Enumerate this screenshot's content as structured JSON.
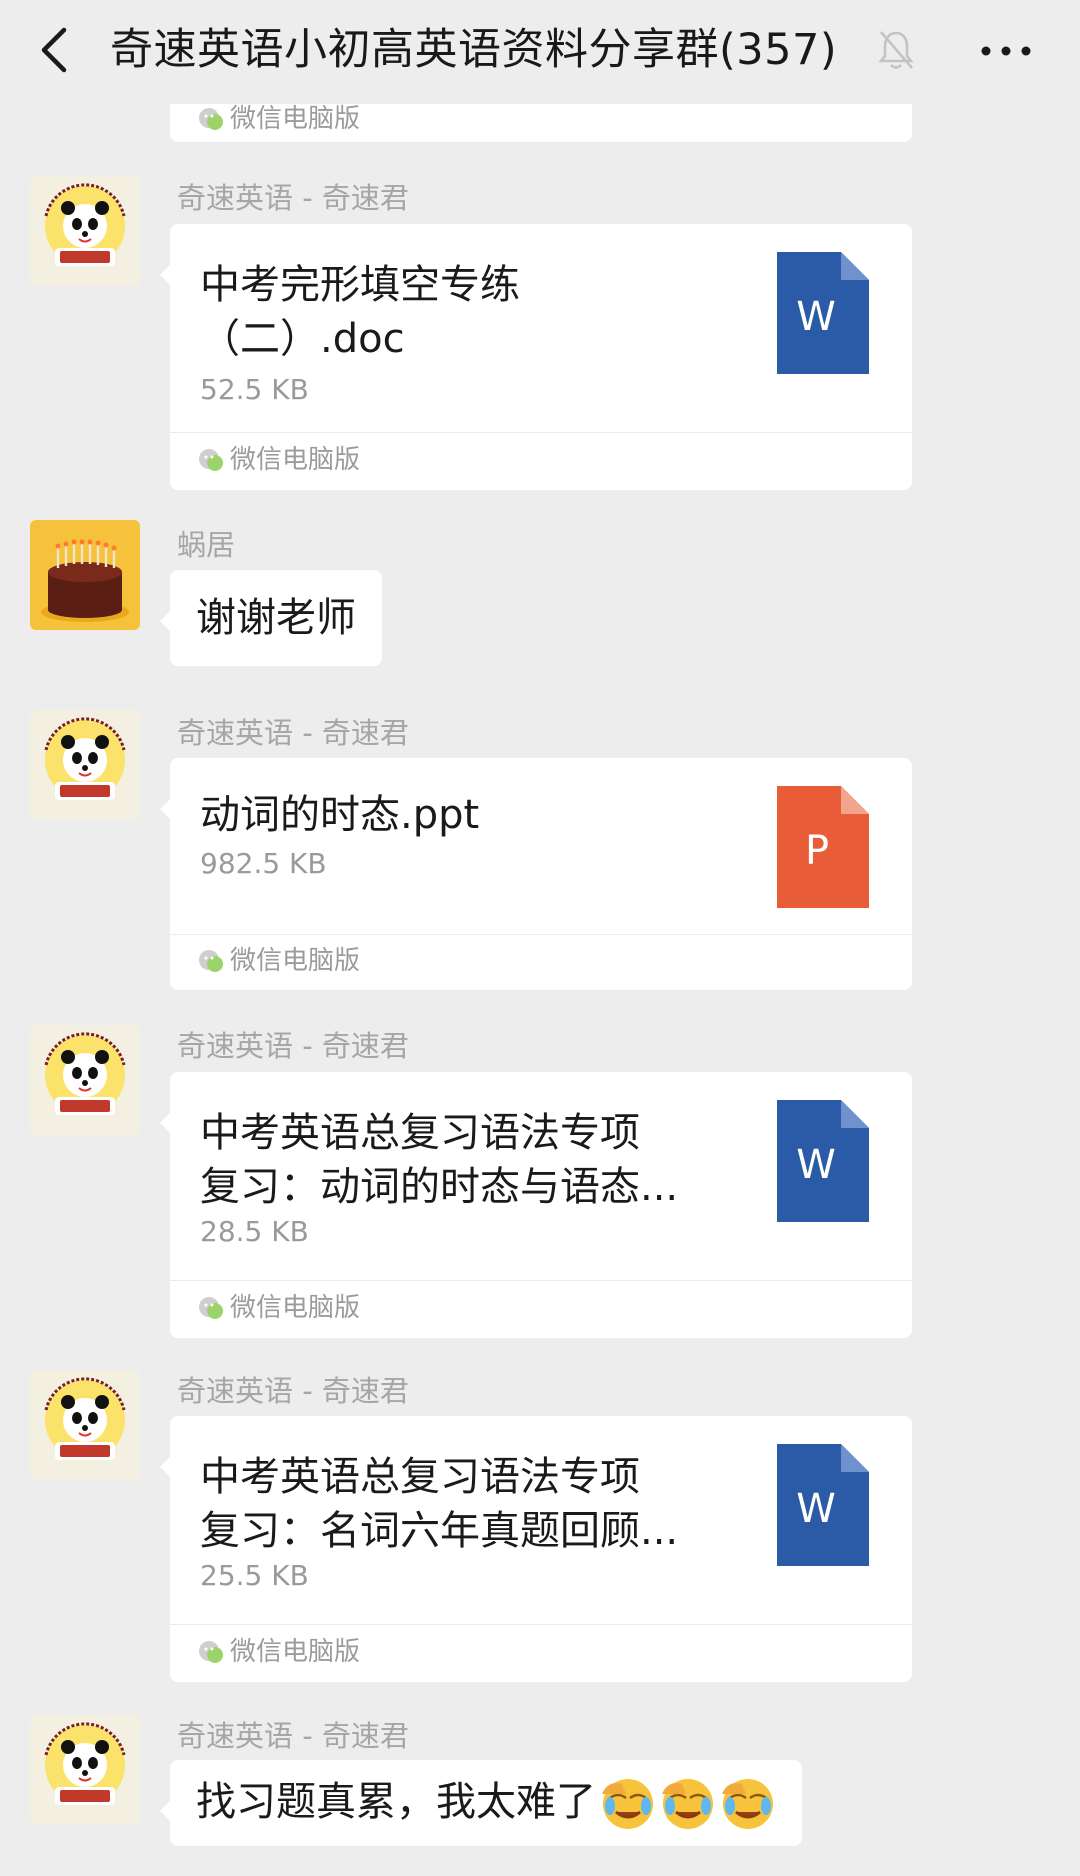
{
  "header": {
    "back_icon": "chevron-left-icon",
    "title": "奇速英语小初高英语资料分享群(357)",
    "mute_icon": "bell-muted-icon",
    "more_icon": "more-dots-icon"
  },
  "colors": {
    "background": "#ededed",
    "bubble": "#ffffff",
    "word_blue": "#2b5aa6",
    "ppt_orange": "#e85d38",
    "muted_text": "#9b9b9b"
  },
  "messages": [
    {
      "type": "file-partial",
      "source": "微信电脑版"
    },
    {
      "type": "file",
      "sender": "奇速英语 - 奇速君",
      "file_name": "中考完形填空专练\n（二）.doc",
      "file_size": "52.5 KB",
      "file_icon": "W",
      "file_kind": "word",
      "source": "微信电脑版"
    },
    {
      "type": "text",
      "sender": "蜗居",
      "text": "谢谢老师"
    },
    {
      "type": "file",
      "sender": "奇速英语 - 奇速君",
      "file_name": "动词的时态.ppt",
      "file_size": "982.5 KB",
      "file_icon": "P",
      "file_kind": "powerpoint",
      "source": "微信电脑版"
    },
    {
      "type": "file",
      "sender": "奇速英语 - 奇速君",
      "file_name": "中考英语总复习语法专项\n复习：动词的时态与语态...",
      "file_size": "28.5 KB",
      "file_icon": "W",
      "file_kind": "word",
      "source": "微信电脑版"
    },
    {
      "type": "file",
      "sender": "奇速英语 - 奇速君",
      "file_name": "中考英语总复习语法专项\n复习：名词六年真题回顾...",
      "file_size": "25.5 KB",
      "file_icon": "W",
      "file_kind": "word",
      "source": "微信电脑版"
    },
    {
      "type": "text",
      "sender": "奇速英语 - 奇速君",
      "text": "找习题真累，我太难了",
      "emojis": [
        "facepalm-cry-emoji",
        "facepalm-cry-emoji",
        "facepalm-cry-emoji"
      ]
    }
  ],
  "avatars": {
    "qisu": {
      "label": "夏令营",
      "ring_text": "奇速英语国际精英特训营"
    },
    "woju": {
      "icon": "birthday-cake-icon"
    }
  }
}
